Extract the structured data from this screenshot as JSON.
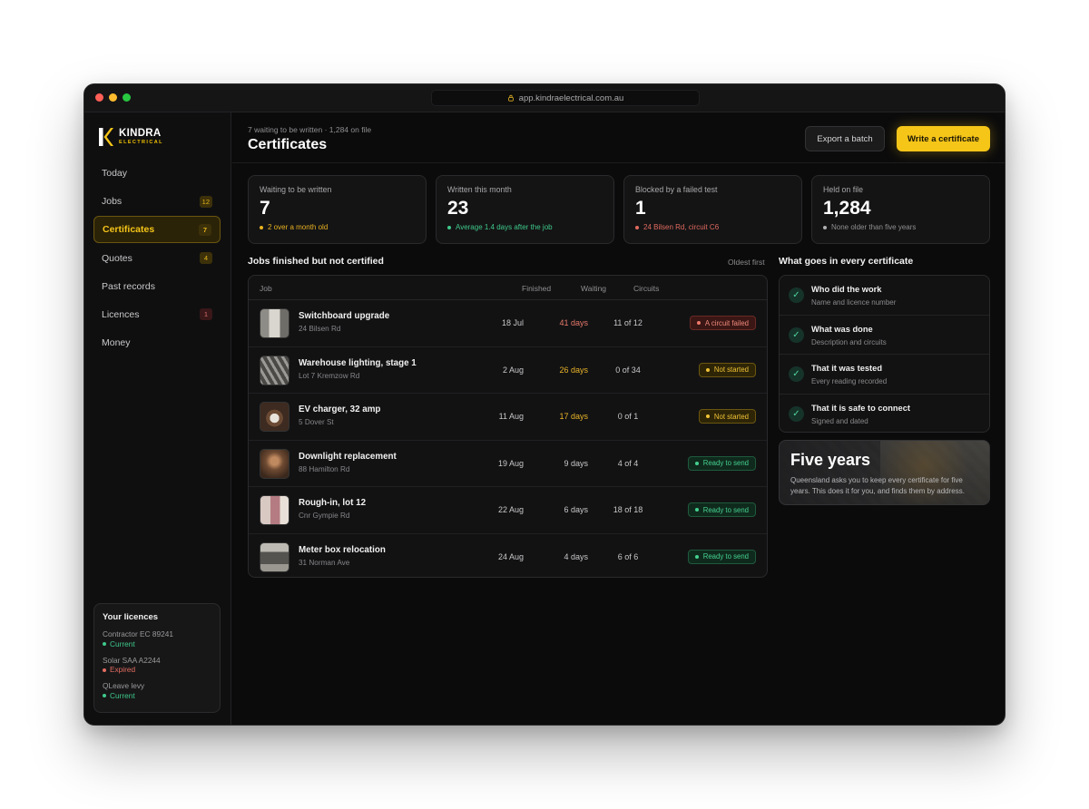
{
  "browser": {
    "url": "app.kindraelectrical.com.au"
  },
  "brand": {
    "name": "KINDRA",
    "sub": "ELECTRICAL",
    "accent": "#f5c518"
  },
  "sidebar": {
    "items": [
      {
        "label": "Today",
        "badge": ""
      },
      {
        "label": "Jobs",
        "badge": "12"
      },
      {
        "label": "Certificates",
        "badge": "7"
      },
      {
        "label": "Quotes",
        "badge": "4"
      },
      {
        "label": "Past records",
        "badge": ""
      },
      {
        "label": "Licences",
        "badge": "1"
      },
      {
        "label": "Money",
        "badge": ""
      }
    ]
  },
  "licences": {
    "title": "Your licences",
    "items": [
      {
        "name": "Contractor EC 89241",
        "status": "Current"
      },
      {
        "name": "Solar SAA A2244",
        "status": "Expired"
      },
      {
        "name": "QLeave levy",
        "status": "Current"
      }
    ]
  },
  "header": {
    "subtitle": "7 waiting to be written · 1,284 on file",
    "title": "Certificates",
    "export_label": "Export a batch",
    "write_label": "Write a certificate"
  },
  "stats": [
    {
      "label": "Waiting to be written",
      "value": "7",
      "note": "2 over a month old"
    },
    {
      "label": "Written this month",
      "value": "23",
      "note": "Average 1.4 days after the job"
    },
    {
      "label": "Blocked by a failed test",
      "value": "1",
      "note": "24 Bilsen Rd, circuit C6"
    },
    {
      "label": "Held on file",
      "value": "1,284",
      "note": "None older than five years"
    }
  ],
  "jobs": {
    "title": "Jobs finished but not certified",
    "sort": "Oldest first",
    "columns": {
      "job": "Job",
      "finished": "Finished",
      "waiting": "Waiting",
      "circuits": "Circuits"
    },
    "rows": [
      {
        "name": "Switchboard upgrade",
        "address": "24 Bilsen Rd",
        "finished": "18 Jul",
        "waiting": "41 days",
        "circuits": "11 of 12",
        "status": "A circuit failed"
      },
      {
        "name": "Warehouse lighting, stage 1",
        "address": "Lot 7 Kremzow Rd",
        "finished": "2 Aug",
        "waiting": "26 days",
        "circuits": "0 of 34",
        "status": "Not started"
      },
      {
        "name": "EV charger, 32 amp",
        "address": "5 Dover St",
        "finished": "11 Aug",
        "waiting": "17 days",
        "circuits": "0 of 1",
        "status": "Not started"
      },
      {
        "name": "Downlight replacement",
        "address": "88 Hamilton Rd",
        "finished": "19 Aug",
        "waiting": "9 days",
        "circuits": "4 of 4",
        "status": "Ready to send"
      },
      {
        "name": "Rough-in, lot 12",
        "address": "Cnr Gympie Rd",
        "finished": "22 Aug",
        "waiting": "6 days",
        "circuits": "18 of 18",
        "status": "Ready to send"
      },
      {
        "name": "Meter box relocation",
        "address": "31 Norman Ave",
        "finished": "24 Aug",
        "waiting": "4 days",
        "circuits": "6 of 6",
        "status": "Ready to send"
      }
    ]
  },
  "checklist": {
    "title": "What goes in every certificate",
    "items": [
      {
        "title": "Who did the work",
        "sub": "Name and licence number"
      },
      {
        "title": "What was done",
        "sub": "Description and circuits"
      },
      {
        "title": "That it was tested",
        "sub": "Every reading recorded"
      },
      {
        "title": "That it is safe to connect",
        "sub": "Signed and dated"
      }
    ]
  },
  "promo": {
    "title": "Five years",
    "text": "Queensland asks you to keep every certificate for five years. This does it for you, and finds them by address."
  }
}
